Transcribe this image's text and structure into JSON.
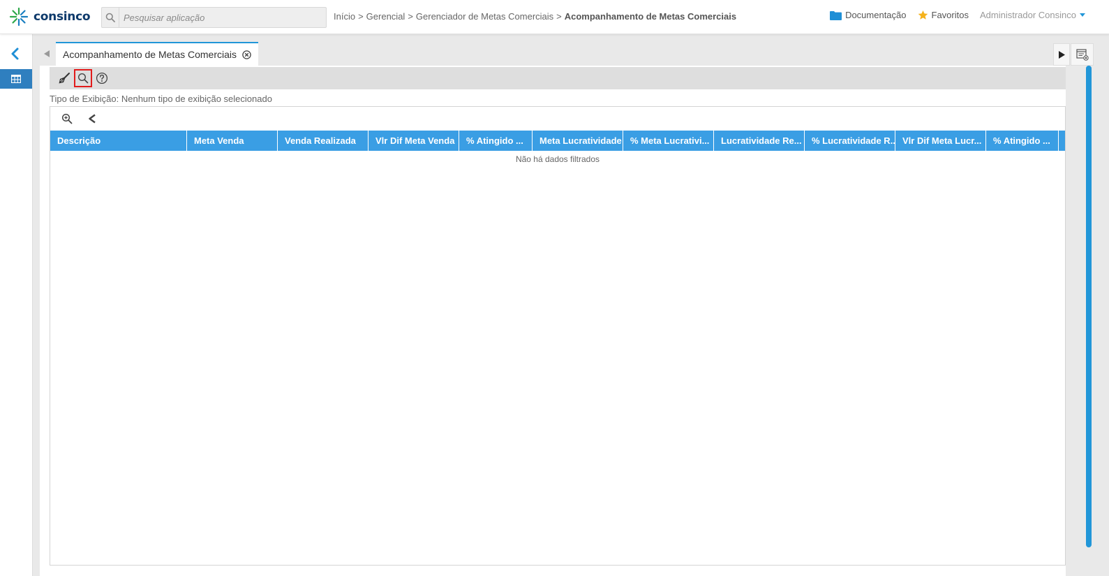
{
  "header": {
    "logo_text": "consinco",
    "search_placeholder": "Pesquisar aplicação",
    "breadcrumb": [
      {
        "label": "Início"
      },
      {
        "label": "Gerencial"
      },
      {
        "label": "Gerenciador de Metas Comerciais"
      },
      {
        "label": "Acompanhamento de Metas Comerciais",
        "current": true
      }
    ],
    "breadcrumb_separator": ">",
    "documentation_label": "Documentação",
    "favorites_label": "Favoritos",
    "user_name": "Administrador Consinco"
  },
  "tabs": [
    {
      "label": "Acompanhamento de Metas Comerciais",
      "active": true
    }
  ],
  "exibicao_label": "Tipo de Exibição: Nenhum tipo de exibição selecionado",
  "grid": {
    "columns": [
      {
        "label": "Descrição"
      },
      {
        "label": "Meta Venda"
      },
      {
        "label": "Venda Realizada"
      },
      {
        "label": "Vlr Dif Meta Venda"
      },
      {
        "label": "% Atingido ..."
      },
      {
        "label": "Meta Lucratividade"
      },
      {
        "label": "% Meta Lucrativi..."
      },
      {
        "label": "Lucratividade Re..."
      },
      {
        "label": "% Lucratividade R..."
      },
      {
        "label": "Vlr Dif Meta Lucr..."
      },
      {
        "label": "% Atingido ..."
      }
    ],
    "empty_message": "Não há dados filtrados"
  },
  "colors": {
    "accent": "#2196d8",
    "grid_header": "#3a9ee4",
    "sidebar_active": "#2f7fbf",
    "highlight": "#e21b1b",
    "favorites_star": "#f5b21b"
  },
  "icons": {
    "logo": "consinco-logo-icon",
    "search": "search-icon",
    "documentation": "folder-icon",
    "favorites": "star-icon",
    "sidebar_back": "chevron-left-icon",
    "sidebar_item": "calendar-grid-icon",
    "toolbar": [
      "broom-icon",
      "search-icon",
      "help-icon"
    ],
    "grid_toolbar": [
      "zoom-in-icon",
      "chevron-left-icon"
    ]
  }
}
